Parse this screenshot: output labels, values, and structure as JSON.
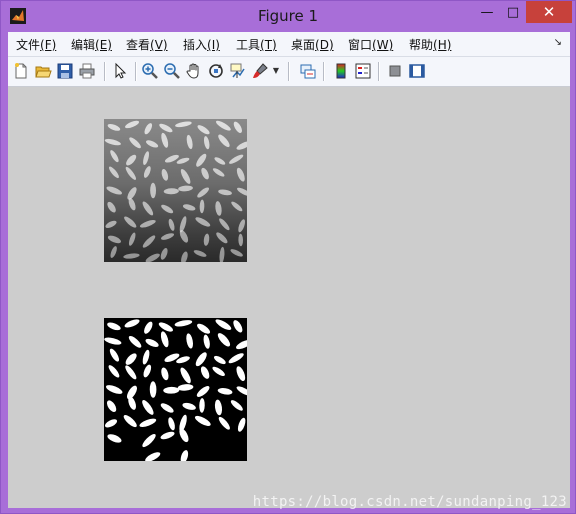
{
  "window": {
    "title": "Figure 1"
  },
  "controls": {
    "minimize": "—",
    "maximize": "□",
    "close": "✕"
  },
  "menu": [
    {
      "label": "文件",
      "key": "(F)"
    },
    {
      "label": "编辑",
      "key": "(E)"
    },
    {
      "label": "查看",
      "key": "(V)"
    },
    {
      "label": "插入",
      "key": "(I)"
    },
    {
      "label": "工具",
      "key": "(T)"
    },
    {
      "label": "桌面",
      "key": "(D)"
    },
    {
      "label": "窗口",
      "key": "(W)"
    },
    {
      "label": "帮助",
      "key": "(H)"
    }
  ],
  "toolbar_icons": [
    "new-figure-icon",
    "open-file-icon",
    "save-icon",
    "print-icon",
    "select-pointer-icon",
    "zoom-in-icon",
    "zoom-out-icon",
    "pan-hand-icon",
    "rotate-3d-icon",
    "data-cursor-icon",
    "brush-icon",
    "brush-dropdown-icon",
    "link-plot-icon",
    "colorbar-icon",
    "legend-icon",
    "hide-plot-tools-icon",
    "show-plot-tools-icon"
  ],
  "watermark": "https://blog.csdn.net/sundanping_123",
  "colors": {
    "titlebar": "#a86ed8",
    "canvas": "#cdcdcd",
    "close": "#c7413b"
  }
}
